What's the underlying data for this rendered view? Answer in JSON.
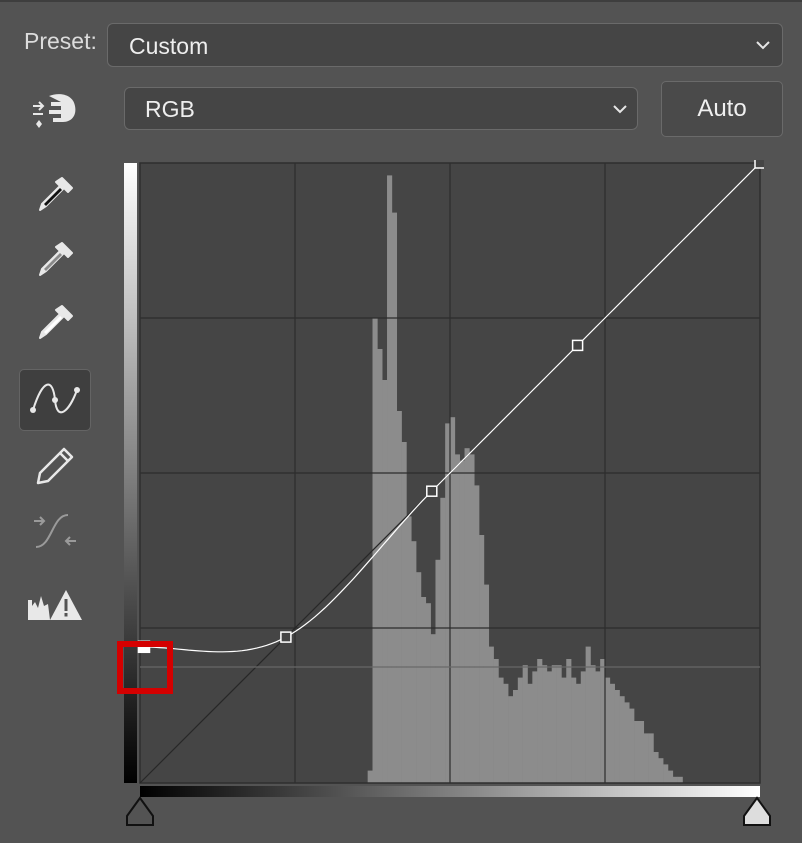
{
  "preset": {
    "label": "Preset:",
    "value": "Custom"
  },
  "channel": {
    "value": "RGB"
  },
  "auto_button": {
    "label": "Auto"
  },
  "tools": [
    {
      "name": "on-image-adjust-icon"
    },
    {
      "name": "black-point-eyedropper-icon"
    },
    {
      "name": "gray-point-eyedropper-icon"
    },
    {
      "name": "white-point-eyedropper-icon"
    },
    {
      "name": "curve-point-tool-icon",
      "active": true
    },
    {
      "name": "pencil-draw-icon"
    },
    {
      "name": "smooth-curve-icon",
      "disabled": true
    },
    {
      "name": "clipping-warning-icon"
    }
  ],
  "curve": {
    "control_points": [
      [
        0,
        56
      ],
      [
        60,
        60
      ],
      [
        120,
        120
      ],
      [
        180,
        180
      ],
      [
        255,
        255
      ]
    ],
    "selected_point_index": 0,
    "range": [
      0,
      255
    ]
  },
  "histogram": {
    "bin_count": 128,
    "levels": [
      0,
      0,
      0,
      0,
      0,
      0,
      0,
      0,
      0,
      0,
      0,
      0,
      0,
      0,
      0,
      0,
      0,
      0,
      0,
      0,
      0,
      0,
      0,
      0,
      0,
      0,
      0,
      0,
      0,
      0,
      0,
      0,
      0,
      0,
      0,
      0,
      0,
      0,
      0,
      0,
      0,
      0,
      0,
      0,
      0,
      0,
      0,
      0.02,
      0.75,
      0.7,
      0.65,
      0.98,
      0.92,
      0.6,
      0.55,
      0.43,
      0.39,
      0.34,
      0.3,
      0.29,
      0.24,
      0.36,
      0.46,
      0.58,
      0.59,
      0.53,
      0.52,
      0.54,
      0.53,
      0.48,
      0.4,
      0.32,
      0.22,
      0.2,
      0.17,
      0.16,
      0.14,
      0.15,
      0.17,
      0.19,
      0.16,
      0.18,
      0.2,
      0.19,
      0.18,
      0.19,
      0.19,
      0.17,
      0.2,
      0.17,
      0.16,
      0.18,
      0.22,
      0.19,
      0.18,
      0.2,
      0.17,
      0.16,
      0.15,
      0.14,
      0.13,
      0.12,
      0.1,
      0.1,
      0.08,
      0.08,
      0.05,
      0.04,
      0.03,
      0.02,
      0.01,
      0.01,
      0,
      0,
      0,
      0,
      0,
      0,
      0,
      0,
      0,
      0,
      0,
      0,
      0,
      0,
      0,
      0
    ]
  },
  "colors": {
    "panel_bg": "#535353",
    "graph_bg": "#454545",
    "histogram": "#8c8c8c",
    "curve": "#ffffff",
    "highlight": "#d40000"
  }
}
